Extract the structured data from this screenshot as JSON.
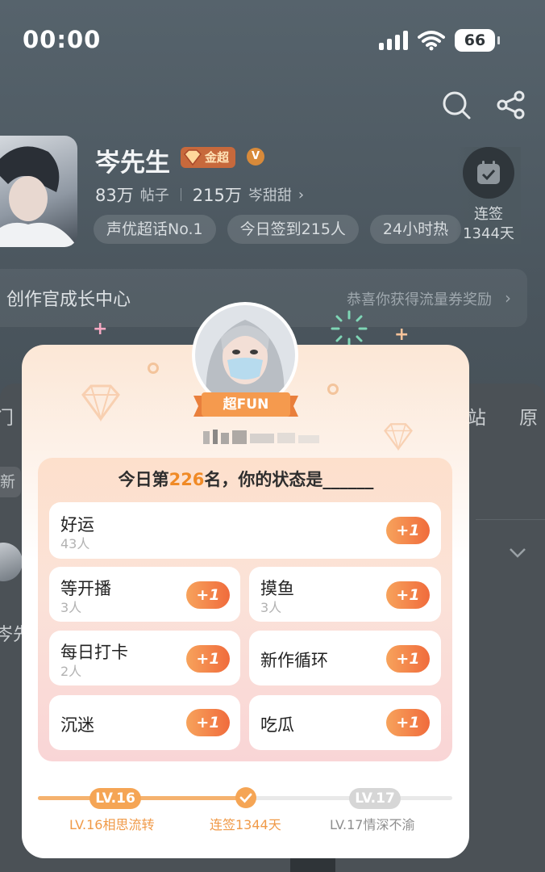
{
  "status_bar": {
    "time": "00:00",
    "battery": "66"
  },
  "profile": {
    "name": "岑先生",
    "badge": "金超",
    "posts_count": "83万",
    "posts_label": "帖子",
    "fans_count": "215万",
    "fans_label": "岑甜甜",
    "tags": [
      "声优超话No.1",
      "今日签到215人",
      "24小时热"
    ],
    "checkin_label": "连签",
    "checkin_days": "1344天"
  },
  "growth": {
    "title": "创作官成长中心",
    "reward": "恭喜你获得流量券奖励"
  },
  "background_tabs": {
    "left": "门",
    "right1": "站",
    "right2": "原",
    "chip": "新",
    "side_name": "岑先"
  },
  "card": {
    "ribbon": "超FUN",
    "title_prefix": "今日第",
    "rank": "226",
    "title_suffix": "名，你的状态是______",
    "plus_label": "+1",
    "options": [
      {
        "label": "好运",
        "count": "43人"
      },
      {
        "label": "等开播",
        "count": "3人"
      },
      {
        "label": "摸鱼",
        "count": "3人"
      },
      {
        "label": "每日打卡",
        "count": "2人"
      },
      {
        "label": "新作循环",
        "count": ""
      },
      {
        "label": "沉迷",
        "count": ""
      },
      {
        "label": "吃瓜",
        "count": ""
      }
    ],
    "progress": {
      "current_level": "LV.16",
      "next_level": "LV.17",
      "current_caption": "LV.16相思流转",
      "middle_caption": "连签1344天",
      "next_caption": "LV.17情深不渝",
      "fraction": 0.5
    }
  },
  "colors": {
    "accent_orange": "#f08a26",
    "plus_gradient_start": "#f7a35c",
    "plus_gradient_end": "#f06b3c"
  }
}
